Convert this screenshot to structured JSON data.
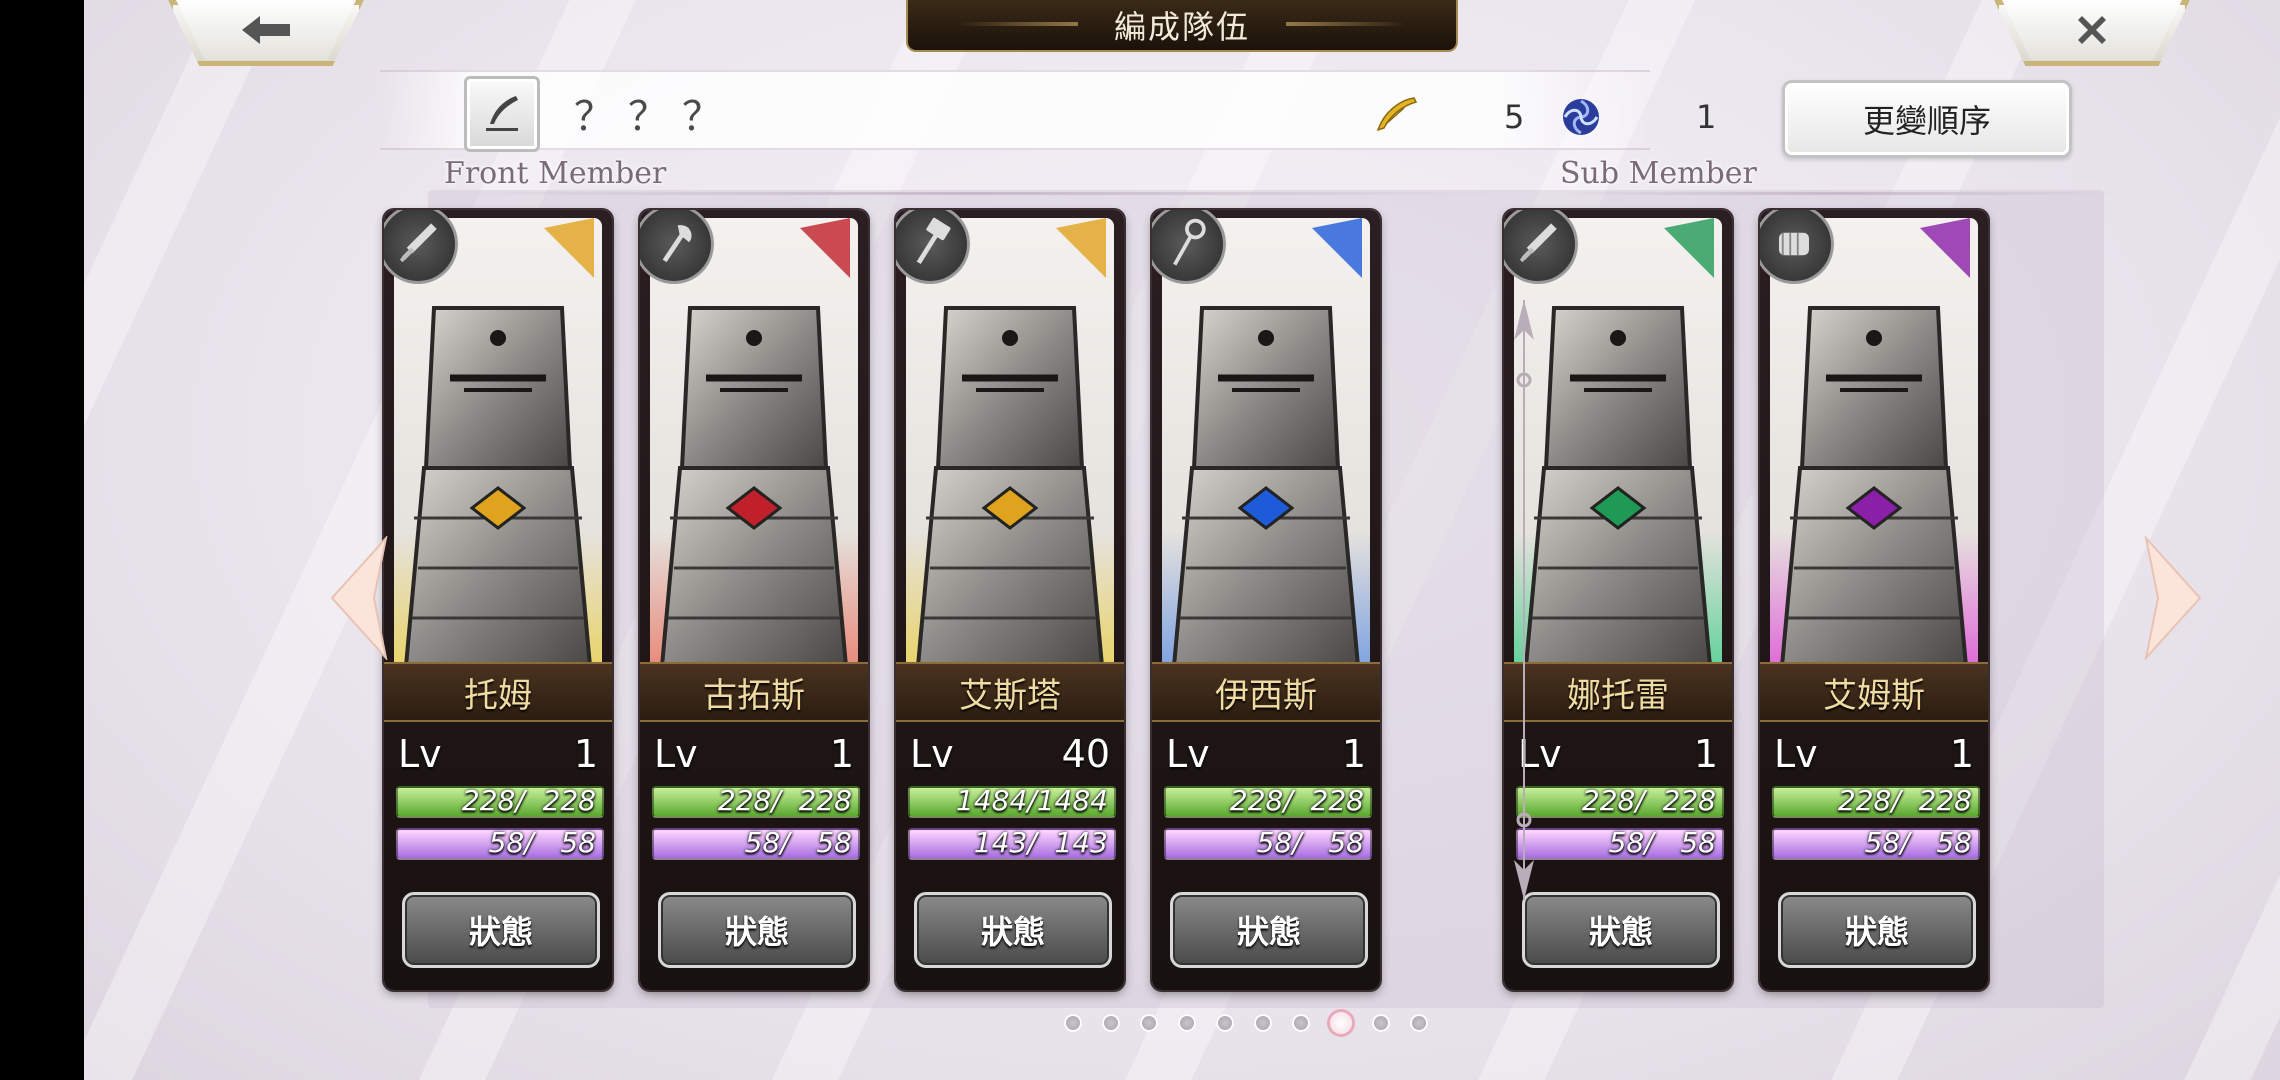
{
  "header": {
    "title": "編成隊伍",
    "back_icon": "back-arrow-icon",
    "close_icon": "close-x-icon"
  },
  "party": {
    "name": "？？？",
    "feather_count": "5",
    "orb_count": "1",
    "reorder_label": "更變順序"
  },
  "sections": {
    "front_label": "Front Member",
    "sub_label": "Sub Member"
  },
  "members": [
    {
      "name": "托姆",
      "lv_label": "Lv",
      "level": "1",
      "hp": "228/  228",
      "mp": "58/   58",
      "status": "狀態",
      "weapon": "sword",
      "accent": "#e0a31d",
      "tint": "#e8d46a"
    },
    {
      "name": "古拓斯",
      "lv_label": "Lv",
      "level": "1",
      "hp": "228/  228",
      "mp": "58/   58",
      "status": "狀態",
      "weapon": "axe",
      "accent": "#c0202a",
      "tint": "#e88a7a"
    },
    {
      "name": "艾斯塔",
      "lv_label": "Lv",
      "level": "40",
      "hp": "1484/1484",
      "mp": "143/  143",
      "status": "狀態",
      "weapon": "hammer",
      "accent": "#e0a31d",
      "tint": "#e8d46a"
    },
    {
      "name": "伊西斯",
      "lv_label": "Lv",
      "level": "1",
      "hp": "228/  228",
      "mp": "58/   58",
      "status": "狀態",
      "weapon": "staff",
      "accent": "#1e5bd8",
      "tint": "#7fa3e0"
    },
    {
      "name": "娜托雷",
      "lv_label": "Lv",
      "level": "1",
      "hp": "228/  228",
      "mp": "58/   58",
      "status": "狀態",
      "weapon": "sword",
      "accent": "#1f9a55",
      "tint": "#62d29a"
    },
    {
      "name": "艾姆斯",
      "lv_label": "Lv",
      "level": "1",
      "hp": "228/  228",
      "mp": "58/   58",
      "status": "狀態",
      "weapon": "fist",
      "accent": "#8a1fa8",
      "tint": "#e06ad8"
    }
  ],
  "pagination": {
    "count": 10,
    "active_index": 7
  },
  "colors": {
    "hp_bar": "#7ccd4a",
    "mp_bar": "#c89cf0",
    "name_text": "#f0dba2"
  }
}
